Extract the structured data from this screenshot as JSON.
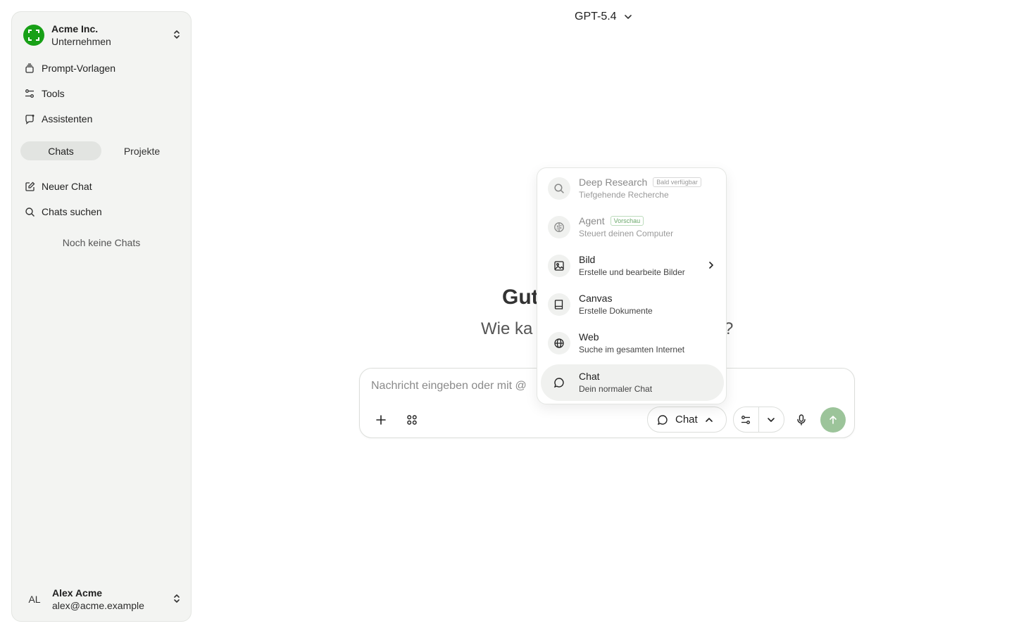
{
  "sidebar": {
    "org": {
      "name": "Acme Inc.",
      "subtitle": "Unternehmen",
      "logo_color": "#18a017"
    },
    "nav": [
      {
        "label": "Prompt-Vorlagen",
        "icon": "stack-icon"
      },
      {
        "label": "Tools",
        "icon": "sliders-icon"
      },
      {
        "label": "Assistenten",
        "icon": "assistant-icon"
      }
    ],
    "tabs": [
      {
        "label": "Chats",
        "active": true
      },
      {
        "label": "Projekte",
        "active": false
      }
    ],
    "actions": [
      {
        "label": "Neuer Chat",
        "icon": "edit-icon"
      },
      {
        "label": "Chats suchen",
        "icon": "search-icon"
      }
    ],
    "empty_note": "Noch keine Chats",
    "user": {
      "initials": "AL",
      "name": "Alex Acme",
      "email": "alex@acme.example"
    }
  },
  "header": {
    "model": "GPT-5.4"
  },
  "greeting": {
    "title": "Gut",
    "subtitle_left": "Wie ka",
    "subtitle_right": "?"
  },
  "composer": {
    "placeholder": "Nachricht eingeben oder mit @",
    "mode_label": "Chat",
    "send_color": "#9cc49a"
  },
  "dropdown": {
    "items": [
      {
        "title": "Deep Research",
        "desc": "Tiefgehende Recherche",
        "badge": "Bald verfügbar",
        "icon": "search-icon",
        "disabled": true
      },
      {
        "title": "Agent",
        "desc": "Steuert deinen Computer",
        "badge": "Vorschau",
        "icon": "brain-icon",
        "disabled": true
      },
      {
        "title": "Bild",
        "desc": "Erstelle und bearbeite Bilder",
        "icon": "image-icon",
        "submenu": true
      },
      {
        "title": "Canvas",
        "desc": "Erstelle Dokumente",
        "icon": "book-icon"
      },
      {
        "title": "Web",
        "desc": "Suche im gesamten Internet",
        "icon": "globe-icon"
      },
      {
        "title": "Chat",
        "desc": "Dein normaler Chat",
        "icon": "chat-bubble-icon",
        "active": true
      }
    ]
  }
}
